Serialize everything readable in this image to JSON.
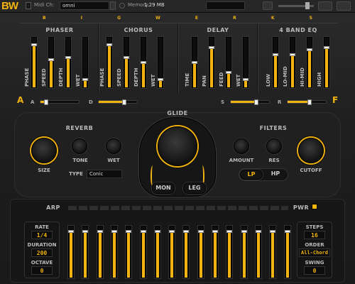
{
  "brand": {
    "logo": "BW",
    "accent": "#f2b310"
  },
  "topbar": {
    "midi_label": "Midi Ch:",
    "midi_value": "omni",
    "memory_label": "Memory:",
    "memory_value": "1.29 MB"
  },
  "title_letters": [
    "B",
    "I",
    "G",
    "W",
    "E",
    "R",
    "K",
    "S"
  ],
  "fx": {
    "phaser": {
      "title": "PHASER",
      "faders": [
        {
          "label": "PHASE",
          "value": 0.85
        },
        {
          "label": "SPEED",
          "value": 0.55
        },
        {
          "label": "DEPTH",
          "value": 0.6
        },
        {
          "label": "WET",
          "value": 0.15
        }
      ],
      "slider_letter": "A",
      "slider_value": 0.15
    },
    "chorus": {
      "title": "CHORUS",
      "faders": [
        {
          "label": "PHASE",
          "value": 0.85
        },
        {
          "label": "SPEED",
          "value": 0.6
        },
        {
          "label": "DEPTH",
          "value": 0.5
        },
        {
          "label": "WET",
          "value": 0.15
        }
      ],
      "slider_letter": "D",
      "slider_value": 0.65
    },
    "delay": {
      "title": "DELAY",
      "faders": [
        {
          "label": "TIME",
          "value": 0.5
        },
        {
          "label": "PAN",
          "value": 0.8
        },
        {
          "label": "FEED",
          "value": 0.3
        },
        {
          "label": "WET",
          "value": 0.15
        }
      ],
      "slider_letter": "S",
      "slider_value": 0.65
    },
    "eq": {
      "title": "4 BAND EQ",
      "faders": [
        {
          "label": "LOW",
          "value": 0.65
        },
        {
          "label": "LO-MID",
          "value": 0.65
        },
        {
          "label": "HI-MID",
          "value": 0.75
        },
        {
          "label": "HIGH",
          "value": 0.8
        }
      ],
      "slider_letter": "R",
      "slider_value": 0.55
    }
  },
  "morph": {
    "left": "A",
    "right": "F"
  },
  "glide": {
    "label": "GLIDE",
    "mon_label": "MON",
    "leg_label": "LEG"
  },
  "reverb": {
    "title": "REVERB",
    "size_label": "SIZE",
    "tone_label": "TONE",
    "wet_label": "WET",
    "type_label": "TYPE",
    "type_value": "Conic"
  },
  "filters": {
    "title": "FILTERS",
    "amount_label": "AMOUNT",
    "res_label": "RES",
    "cutoff_label": "CUTOFF",
    "lp_label": "LP",
    "hp_label": "HP"
  },
  "arp": {
    "label": "ARP",
    "pwr_label": "PWR",
    "rate_label": "RATE",
    "rate_value": "1/4",
    "duration_label": "DURATION",
    "duration_value": "200",
    "octave_label": "OCTAVE",
    "octave_value": "0",
    "steps_label": "STEPS",
    "steps_value": "16",
    "order_label": "ORDER",
    "order_value": "All-Chord",
    "swing_label": "SWING",
    "swing_value": "0",
    "step_values": [
      0.9,
      0.9,
      0.9,
      0.9,
      0.9,
      0.9,
      0.9,
      0.9,
      0.9,
      0.9,
      0.9,
      0.9,
      0.9,
      0.9,
      0.9,
      0.9
    ]
  }
}
